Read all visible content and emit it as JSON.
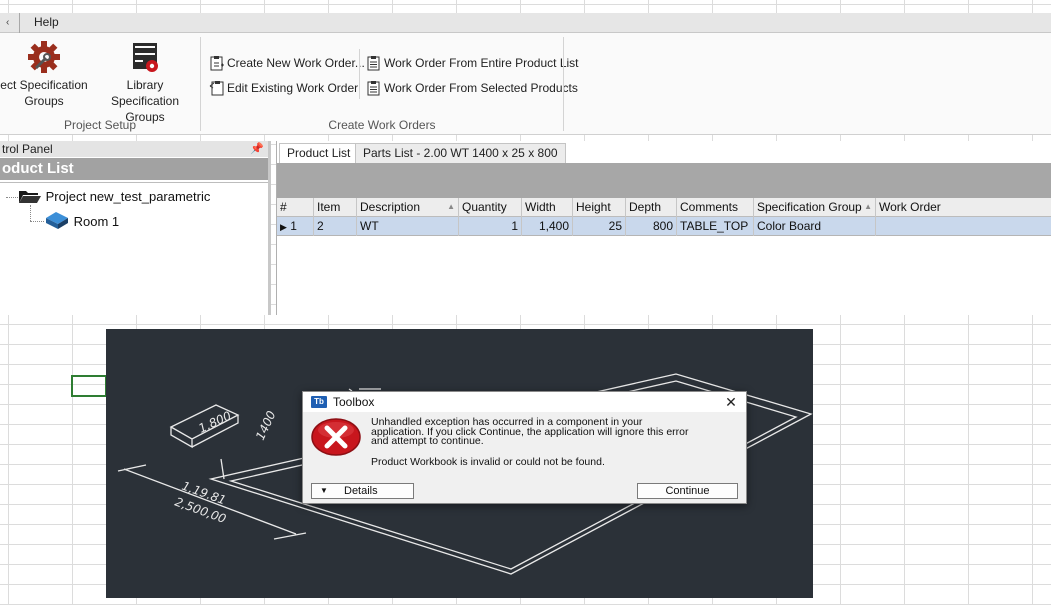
{
  "ribbon": {
    "tabs": [
      {
        "label": "Help"
      }
    ],
    "groups": {
      "project_setup": {
        "label": "Project Setup",
        "buttons": [
          {
            "label_line1": "ect Specification",
            "label_line2": "Groups",
            "icon": "gear-wrench-icon"
          },
          {
            "label_line1": "Library Specification",
            "label_line2": "Groups",
            "icon": "library-cabinet-icon"
          }
        ]
      },
      "create_work_orders": {
        "label": "Create Work Orders",
        "buttons": [
          {
            "label": "Create New Work Order...",
            "icon": "clipboard-new-icon"
          },
          {
            "label": "Edit Existing Work Order",
            "icon": "clipboard-edit-icon"
          },
          {
            "label": "Work Order From Entire Product List",
            "icon": "clipboard-list-icon"
          },
          {
            "label": "Work Order From Selected Products",
            "icon": "clipboard-list-icon"
          }
        ]
      }
    }
  },
  "control_panel": {
    "title": "trol Panel",
    "header": "oduct List",
    "tree": [
      {
        "label": "Project new_test_parametric",
        "icon": "open-folder-icon"
      },
      {
        "label": "Room 1",
        "icon": "room-icon"
      }
    ]
  },
  "product_grid": {
    "tabs": [
      {
        "label": "Product List",
        "active": true
      },
      {
        "label": "Parts List - 2.00 WT 1400 x 25 x 800",
        "active": false
      }
    ],
    "columns": [
      "#",
      "Item",
      "Description",
      "Quantity",
      "Width",
      "Height",
      "Depth",
      "Comments",
      "Specification Group",
      "Work Order"
    ],
    "rows": [
      {
        "index": "1",
        "item": "2",
        "description": "WT",
        "quantity": "1",
        "width": "1,400",
        "height": "25",
        "depth": "800",
        "comments": "TABLE_TOP",
        "spec_group": "Color Board",
        "work_order": ""
      }
    ]
  },
  "dialog": {
    "app_icon_text": "Tb",
    "title": "Toolbox",
    "message_line1": "Unhandled exception has occurred in a component in your",
    "message_line2": "application. If you click Continue, the application will ignore this error",
    "message_line3": "and attempt to continue.",
    "detail": "Product Workbook is invalid or could not be found.",
    "details_button": "Details",
    "continue_button": "Continue",
    "close_glyph": "✕"
  },
  "cad": {
    "label_box": "1,800",
    "label_dim_a": "1400",
    "label_dim_b": "1,19.81",
    "label_dim_c": "2,500,00"
  },
  "colors": {
    "error_red": "#c8161d",
    "selection_row": "#c9d8ec",
    "cad_background": "#2b3138"
  }
}
